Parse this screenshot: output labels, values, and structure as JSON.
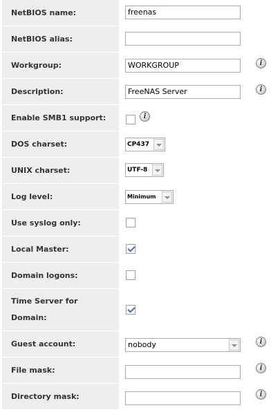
{
  "fields": {
    "netbios_name": {
      "label": "NetBIOS name:",
      "value": "freenas"
    },
    "netbios_alias": {
      "label": "NetBIOS alias:",
      "value": ""
    },
    "workgroup": {
      "label": "Workgroup:",
      "value": "WORKGROUP"
    },
    "description": {
      "label": "Description:",
      "value": "FreeNAS Server"
    },
    "enable_smb1": {
      "label": "Enable SMB1 support:",
      "checked": false
    },
    "dos_charset": {
      "label": "DOS charset:",
      "value": "CP437"
    },
    "unix_charset": {
      "label": "UNIX charset:",
      "value": "UTF-8"
    },
    "log_level": {
      "label": "Log level:",
      "value": "Minimum"
    },
    "use_syslog": {
      "label": "Use syslog only:",
      "checked": false
    },
    "local_master": {
      "label": "Local Master:",
      "checked": true
    },
    "domain_logons": {
      "label": "Domain logons:",
      "checked": false
    },
    "time_server": {
      "label_line1": "Time Server for",
      "label_line2": "Domain:",
      "checked": true
    },
    "guest_account": {
      "label": "Guest account:",
      "value": "nobody"
    },
    "file_mask": {
      "label": "File mask:",
      "value": ""
    },
    "directory_mask": {
      "label": "Directory mask:",
      "value": ""
    }
  },
  "info_glyph": "i",
  "icons": {
    "info": "info-icon",
    "dropdown": "chevron-down-icon",
    "check": "checkmark-icon"
  },
  "colors": {
    "label_bg": "#eeeeee",
    "check": "#4a6fa5",
    "border": "#a9a9a9"
  }
}
